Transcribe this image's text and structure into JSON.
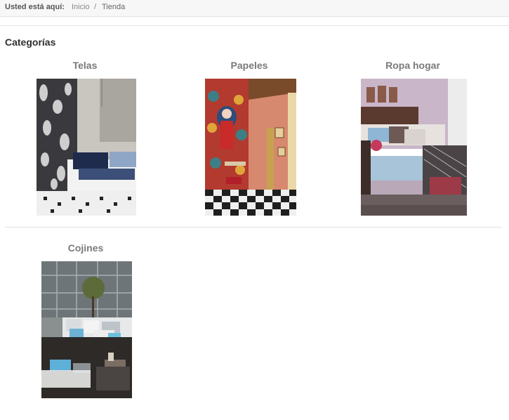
{
  "breadcrumb": {
    "label": "Usted está aquí:",
    "items": [
      "Inicio",
      "Tienda"
    ],
    "separator": "/"
  },
  "section_title": "Categorías",
  "categories": [
    {
      "name": "Telas"
    },
    {
      "name": "Papeles"
    },
    {
      "name": "Ropa hogar"
    },
    {
      "name": "Cojines"
    }
  ]
}
